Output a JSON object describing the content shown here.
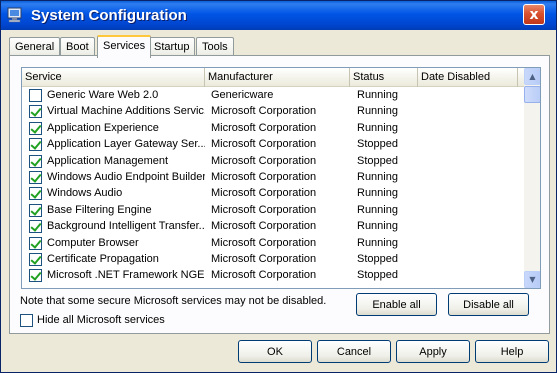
{
  "window": {
    "title": "System Configuration",
    "close_glyph": "x"
  },
  "tabs": [
    {
      "label": "General",
      "active": false
    },
    {
      "label": "Boot",
      "active": false
    },
    {
      "label": "Services",
      "active": true
    },
    {
      "label": "Startup",
      "active": false
    },
    {
      "label": "Tools",
      "active": false
    }
  ],
  "services": {
    "columns": [
      "Service",
      "Manufacturer",
      "Status",
      "Date Disabled"
    ],
    "rows": [
      {
        "checked": false,
        "name": "Generic Ware Web 2.0",
        "manufacturer": "Genericware",
        "status": "Running",
        "date_disabled": ""
      },
      {
        "checked": true,
        "name": "Virtual Machine Additions Servic...",
        "manufacturer": "Microsoft Corporation",
        "status": "Running",
        "date_disabled": ""
      },
      {
        "checked": true,
        "name": "Application Experience",
        "manufacturer": "Microsoft Corporation",
        "status": "Running",
        "date_disabled": ""
      },
      {
        "checked": true,
        "name": "Application Layer Gateway Ser...",
        "manufacturer": "Microsoft Corporation",
        "status": "Stopped",
        "date_disabled": ""
      },
      {
        "checked": true,
        "name": "Application Management",
        "manufacturer": "Microsoft Corporation",
        "status": "Stopped",
        "date_disabled": ""
      },
      {
        "checked": true,
        "name": "Windows Audio Endpoint Builder",
        "manufacturer": "Microsoft Corporation",
        "status": "Running",
        "date_disabled": ""
      },
      {
        "checked": true,
        "name": "Windows Audio",
        "manufacturer": "Microsoft Corporation",
        "status": "Running",
        "date_disabled": ""
      },
      {
        "checked": true,
        "name": "Base Filtering Engine",
        "manufacturer": "Microsoft Corporation",
        "status": "Running",
        "date_disabled": ""
      },
      {
        "checked": true,
        "name": "Background Intelligent Transfer...",
        "manufacturer": "Microsoft Corporation",
        "status": "Running",
        "date_disabled": ""
      },
      {
        "checked": true,
        "name": "Computer Browser",
        "manufacturer": "Microsoft Corporation",
        "status": "Running",
        "date_disabled": ""
      },
      {
        "checked": true,
        "name": "Certificate Propagation",
        "manufacturer": "Microsoft Corporation",
        "status": "Stopped",
        "date_disabled": ""
      },
      {
        "checked": true,
        "name": "Microsoft .NET Framework NGE...",
        "manufacturer": "Microsoft Corporation",
        "status": "Stopped",
        "date_disabled": ""
      }
    ]
  },
  "note": "Note that some secure Microsoft services may not be disabled.",
  "hide_ms": {
    "label": "Hide all Microsoft services",
    "checked": false
  },
  "buttons": {
    "enable_all": "Enable all",
    "disable_all": "Disable all",
    "ok": "OK",
    "cancel": "Cancel",
    "apply": "Apply",
    "help": "Help"
  },
  "icons": {
    "title": "system-configuration-icon",
    "scroll_up": "arrow-up-icon",
    "scroll_down": "arrow-down-icon"
  },
  "colors": {
    "titlebar": "#0055e5",
    "close_button": "#d9502e",
    "check_mark": "#21a121",
    "face": "#ece9d8",
    "active_tab_accent": "#ffc83c"
  }
}
